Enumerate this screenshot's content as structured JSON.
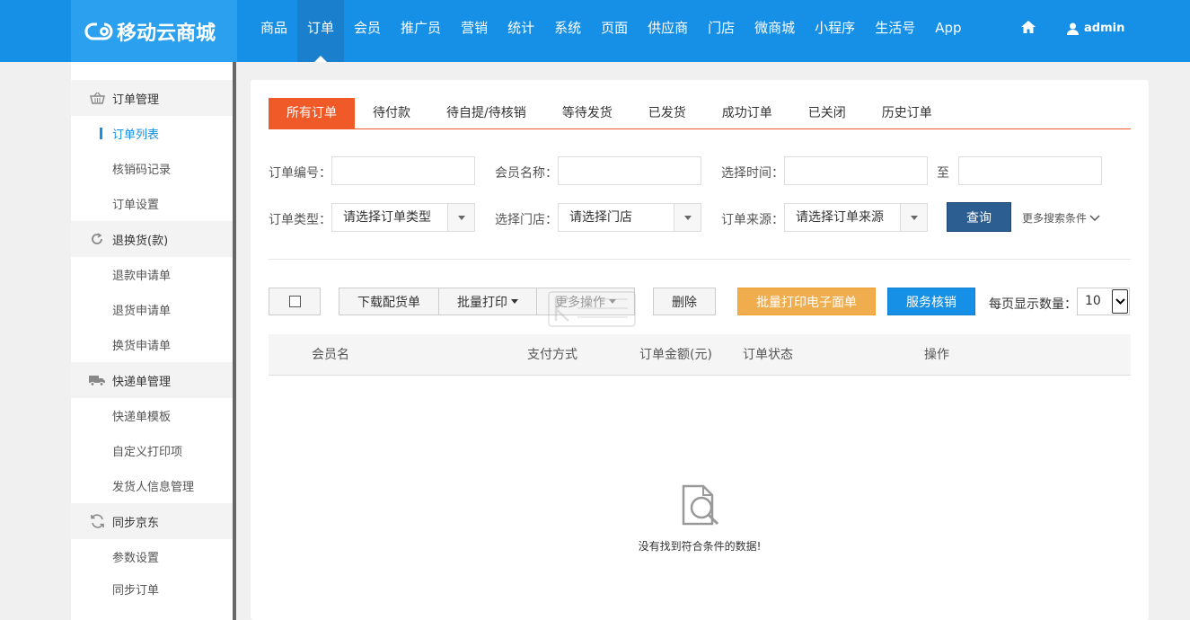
{
  "header": {
    "brand": "移动云商城",
    "nav": [
      "商品",
      "订单",
      "会员",
      "推广员",
      "营销",
      "统计",
      "系统",
      "页面",
      "供应商",
      "门店",
      "微商城",
      "小程序",
      "生活号",
      "App"
    ],
    "active_nav": "订单",
    "user": "admin"
  },
  "sidebar": {
    "groups": [
      {
        "label": "订单管理",
        "icon": "basket-icon",
        "items": [
          "订单列表",
          "核销码记录",
          "订单设置"
        ]
      },
      {
        "label": "退换货(款)",
        "icon": "refresh-icon",
        "items": [
          "退款申请单",
          "退货申请单",
          "换货申请单"
        ]
      },
      {
        "label": "快递单管理",
        "icon": "truck-icon",
        "items": [
          "快递单模板",
          "自定义打印项",
          "发货人信息管理"
        ]
      },
      {
        "label": "同步京东",
        "icon": "sync-icon",
        "items": [
          "参数设置",
          "同步订单"
        ]
      }
    ],
    "active_item": "订单列表"
  },
  "tabs": [
    "所有订单",
    "待付款",
    "待自提/待核销",
    "等待发货",
    "已发货",
    "成功订单",
    "已关闭",
    "历史订单"
  ],
  "active_tab": "所有订单",
  "filters": {
    "order_no_label": "订单编号：",
    "order_no_value": "",
    "member_label": "会员名称：",
    "member_value": "",
    "time_label": "选择时间：",
    "time_to": "至",
    "time_from_value": "",
    "time_to_value": "",
    "type_label": "订单类型：",
    "type_value": "请选择订单类型",
    "store_label": "选择门店：",
    "store_value": "请选择门店",
    "source_label": "订单来源：",
    "source_value": "请选择订单来源",
    "query_button": "查询",
    "more_search": "更多搜索条件"
  },
  "toolbar": {
    "download": "下载配货单",
    "batch_print": "批量打印",
    "more_ops": "更多操作",
    "delete": "删除",
    "batch_print_e": "批量打印电子面单",
    "service_verify": "服务核销",
    "per_page_label": "每页显示数量：",
    "per_page_value": "10"
  },
  "table": {
    "columns": [
      "会员名",
      "支付方式",
      "订单金额(元)",
      "订单状态",
      "操作"
    ],
    "empty_text": "没有找到符合条件的数据!"
  },
  "colors": {
    "topbar": "#1690e6",
    "accent_orange": "#f05a28",
    "query_button": "#2c5e92",
    "print_button": "#f0ad4e"
  }
}
